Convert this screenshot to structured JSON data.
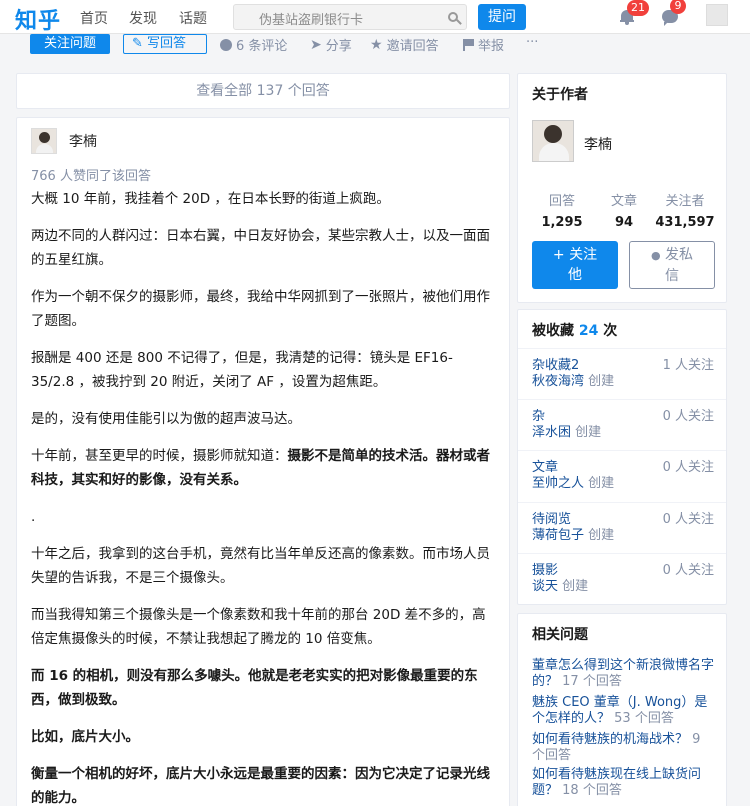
{
  "topbar": {
    "logo": "知乎",
    "nav": [
      "首页",
      "发现",
      "话题"
    ],
    "search_placeholder": "伪基站盗刷银行卡",
    "ask_label": "提问",
    "notification_count": "21",
    "message_count": "9"
  },
  "actions": {
    "follow_question": "关注问题",
    "write_answer": "写回答",
    "comments": "6 条评论",
    "share": "分享",
    "invite": "邀请回答",
    "report": "举报",
    "more": "···"
  },
  "view_all": "查看全部 137 个回答",
  "answer": {
    "author": "李楠",
    "votes": "766 人赞同了该回答",
    "paragraphs": [
      "大概 10 年前，我挂着个 20D ，在日本长野的街道上疯跑。",
      "两边不同的人群闪过：日本右翼，中日友好协会，某些宗教人士，以及一面面的五星红旗。",
      "作为一个朝不保夕的摄影师，最终，我给中华网抓到了一张照片，被他们用作了题图。",
      "报酬是 400 还是 800 不记得了，但是，我清楚的记得：镜头是 EF16-35/2.8 ，被我拧到 20 附近，关闭了 AF ，设置为超焦距。",
      "是的，没有使用佳能引以为傲的超声波马达。",
      "十年前，甚至更早的时候，摄影师就知道：",
      "摄影不是简单的技术活。器材或者科技，其实和好的影像，没有关系。",
      ".",
      "十年之后，我拿到的这台手机，竟然有比当年单反还高的像素数。而市场人员失望的告诉我，不是三个摄像头。",
      "而当我得知第三个摄像头是一个像素数和我十年前的那台 20D 差不多的，高倍定焦摄像头的时候，不禁让我想起了腾龙的 10 倍变焦。",
      "而 16 的相机，则没有那么多噱头。他就是老老实实的把对影像最重要的东西，做到极致。",
      "比如，底片大小。",
      "衡量一个相机的好坏，底片大小永远是最重要的因素：因为它决定了记录光线的能力。"
    ]
  },
  "about": {
    "header": "关于作者",
    "name": "李楠",
    "stats": [
      {
        "label": "回答",
        "value": "1,295"
      },
      {
        "label": "文章",
        "value": "94"
      },
      {
        "label": "关注者",
        "value": "431,597"
      }
    ],
    "follow_line1": "+ 关注",
    "follow_line2": "他",
    "msg_line1": "发私",
    "msg_line2": "信"
  },
  "collected": {
    "header_prefix": "被收藏",
    "count": "24",
    "header_suffix": "次",
    "items": [
      {
        "title": "杂收藏2",
        "user": "秋夜海湾",
        "created": "创建",
        "followers": "1 人关注"
      },
      {
        "title": "杂",
        "user": "泽水困",
        "created": "创建",
        "followers": "0 人关注"
      },
      {
        "title": "文章",
        "user": "至帅之人",
        "created": "创建",
        "followers": "0 人关注"
      },
      {
        "title": "待阅览",
        "user": "薄荷包子",
        "created": "创建",
        "followers": "0 人关注"
      },
      {
        "title": "摄影",
        "user": "谈天",
        "created": "创建",
        "followers": "0 人关注"
      }
    ]
  },
  "related": {
    "header": "相关问题",
    "items": [
      {
        "q": "董章怎么得到这个新浪微博名字的？",
        "c": "17 个回答"
      },
      {
        "q": "魅族 CEO 董章（J. Wong）是个怎样的人？",
        "c": "53 个回答"
      },
      {
        "q": "如何看待魅族的机海战术？",
        "c": "9 个回答"
      },
      {
        "q": "如何看待魅族现在线上缺货问题？",
        "c": "18 个回答"
      }
    ]
  },
  "colors": {
    "brand": "#0f88eb",
    "link": "#175199",
    "muted": "#8590a6",
    "badge": "#f1403c"
  }
}
